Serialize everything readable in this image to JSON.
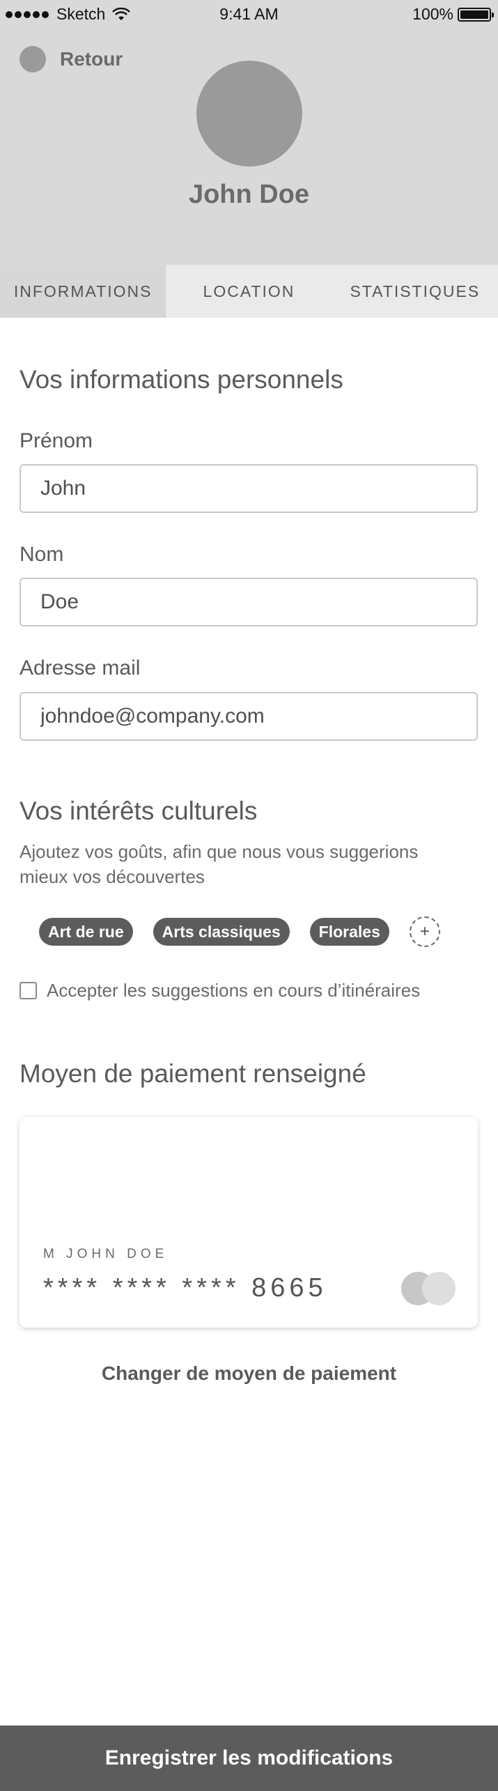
{
  "status_bar": {
    "carrier": "Sketch",
    "time": "9:41 AM",
    "battery": "100%"
  },
  "header": {
    "back_label": "Retour",
    "user_name": "John Doe"
  },
  "tabs": [
    {
      "label": "INFORMATIONS",
      "active": true
    },
    {
      "label": "LOCATION",
      "active": false
    },
    {
      "label": "STATISTIQUES",
      "active": false
    }
  ],
  "personal": {
    "title": "Vos informations personnels",
    "first_name_label": "Prénom",
    "first_name_value": "John",
    "last_name_label": "Nom",
    "last_name_value": "Doe",
    "email_label": "Adresse mail",
    "email_value": "johndoe@company.com"
  },
  "interests": {
    "title": "Vos intérêts culturels",
    "description": "Ajoutez vos goûts, afin que nous vous suggerions mieux vos découvertes",
    "chips": [
      "Art de rue",
      "Arts classiques",
      "Florales"
    ],
    "add_symbol": "+",
    "checkbox_label": "Accepter les suggestions en cours d’itinéraires",
    "checkbox_checked": false
  },
  "payment": {
    "title": "Moyen de paiement renseigné",
    "card_holder": "M JOHN DOE",
    "card_number": "**** **** **** 8665",
    "change_label": "Changer de moyen de paiement"
  },
  "footer": {
    "save_label": "Enregistrer les modifications"
  }
}
